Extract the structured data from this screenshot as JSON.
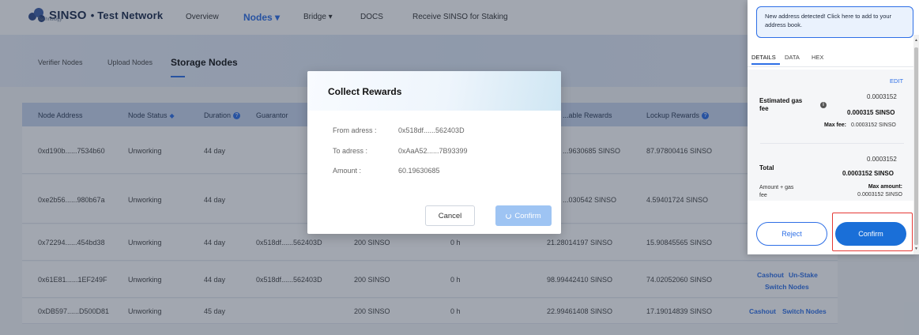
{
  "header": {
    "logo_text": "SINSO",
    "logo_sub": "Technology",
    "network": "• Test Network",
    "nav": [
      "Overview",
      "Nodes ▾",
      "Bridge ▾",
      "DOCS",
      "Receive SINSO for Staking"
    ]
  },
  "subtabs": [
    "Verifier Nodes",
    "Upload Nodes",
    "Storage Nodes"
  ],
  "table": {
    "headers": [
      "Node Address",
      "Node Status",
      "Duration",
      "Guarantor",
      "...able Rewards",
      "Lockup Rewards"
    ],
    "rows": [
      {
        "address": "0xd190b......7534b60",
        "status": "Unworking",
        "duration": "44 day",
        "guarantor": "",
        "stake": "",
        "time": "",
        "available": "...9630685 SINSO",
        "lockup": "87.97800416 SINSO",
        "actions": []
      },
      {
        "address": "0xe2b56......980b67a",
        "status": "Unworking",
        "duration": "44 day",
        "guarantor": "",
        "stake": "",
        "time": "",
        "available": "...030542 SINSO",
        "lockup": "4.59401724 SINSO",
        "actions": []
      },
      {
        "address": "0x72294......454bd38",
        "status": "Unworking",
        "duration": "44 day",
        "guarantor": "0x518df......562403D",
        "stake": "200 SINSO",
        "time": "0 h",
        "available": "21.28014197 SINSO",
        "lockup": "15.90845565 SINSO",
        "actions": []
      },
      {
        "address": "0x61E81......1EF249F",
        "status": "Unworking",
        "duration": "44 day",
        "guarantor": "0x518df......562403D",
        "stake": "200 SINSO",
        "time": "0 h",
        "available": "98.99442410 SINSO",
        "lockup": "74.02052060 SINSO",
        "actions": [
          "Cashout",
          "Un-Stake",
          "Switch Nodes"
        ]
      },
      {
        "address": "0xDB597......D500D81",
        "status": "Unworking",
        "duration": "45 day",
        "guarantor": "",
        "stake": "200 SINSO",
        "time": "0 h",
        "available": "22.99461408 SINSO",
        "lockup": "17.19014839 SINSO",
        "actions": [
          "Cashout",
          "Switch Nodes"
        ]
      }
    ]
  },
  "modal": {
    "title": "Collect Rewards",
    "from_label": "From adress :",
    "from_value": "0x518df......562403D",
    "to_label": "To adress :",
    "to_value": "0xAaA52......7B93399",
    "amount_label": "Amount :",
    "amount_value": "60.19630685",
    "cancel": "Cancel",
    "confirm": "Confirm"
  },
  "wallet": {
    "notice": "New address detected! Click here to add to your address book.",
    "tabs": [
      "DETAILS",
      "DATA",
      "HEX"
    ],
    "edit": "EDIT",
    "gas_label": "Estimated gas fee",
    "gas_value_top": "0.0003152",
    "gas_value_bold": "0.000315 SINSO",
    "max_fee_label": "Max fee:",
    "max_fee_value": "0.0003152 SINSO",
    "total_label": "Total",
    "total_value_top": "0.0003152",
    "total_value_bold": "0.0003152 SINSO",
    "amount_gas_label": "Amount + gas fee",
    "max_amount_label": "Max amount:",
    "max_amount_value": "0.0003152 SINSO",
    "reject": "Reject",
    "confirm": "Confirm"
  },
  "colors": {
    "accent": "#2e6fe6",
    "highlight": "#e53935"
  }
}
